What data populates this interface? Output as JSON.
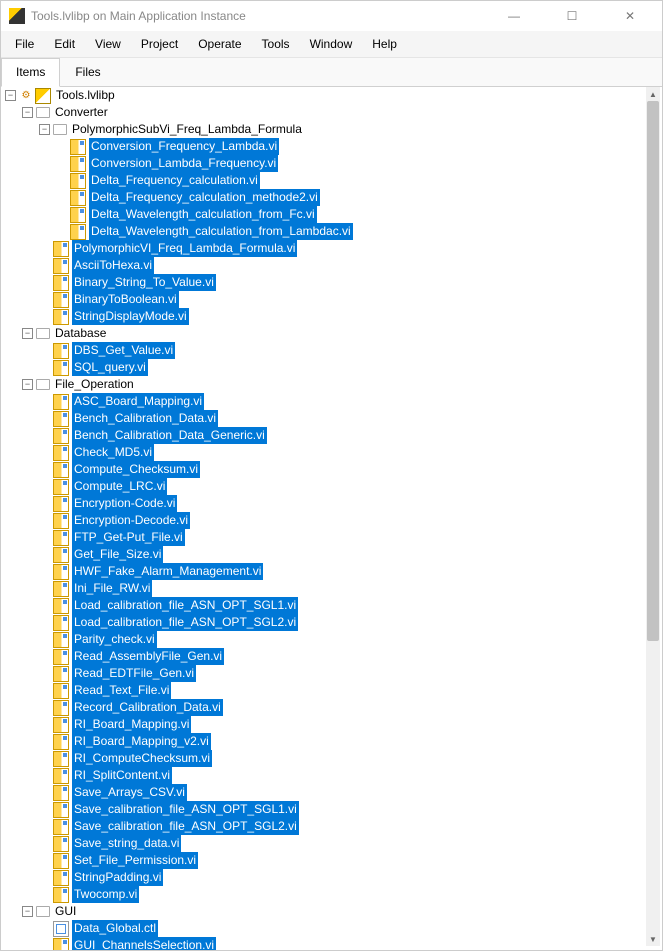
{
  "window": {
    "title": "Tools.lvlibp on Main Application Instance"
  },
  "menu": {
    "items": [
      "File",
      "Edit",
      "View",
      "Project",
      "Operate",
      "Tools",
      "Window",
      "Help"
    ]
  },
  "tabs": {
    "items": [
      "Items",
      "Files"
    ],
    "active": 0
  },
  "tree": {
    "root": {
      "label": "Tools.lvlibp",
      "icon": "lib",
      "expanded": true
    },
    "nodes": [
      {
        "type": "folder",
        "level": 1,
        "label": "Converter",
        "expanded": true,
        "selected": false
      },
      {
        "type": "folder",
        "level": 2,
        "label": "PolymorphicSubVi_Freq_Lambda_Formula",
        "expanded": true,
        "selected": false
      },
      {
        "type": "vi",
        "level": 3,
        "label": "Conversion_Frequency_Lambda.vi",
        "selected": true
      },
      {
        "type": "vi",
        "level": 3,
        "label": "Conversion_Lambda_Frequency.vi",
        "selected": true
      },
      {
        "type": "vi",
        "level": 3,
        "label": "Delta_Frequency_calculation.vi",
        "selected": true
      },
      {
        "type": "vi",
        "level": 3,
        "label": "Delta_Frequency_calculation_methode2.vi",
        "selected": true
      },
      {
        "type": "vi",
        "level": 3,
        "label": "Delta_Wavelength_calculation_from_Fc.vi",
        "selected": true
      },
      {
        "type": "vi",
        "level": 3,
        "label": "Delta_Wavelength_calculation_from_Lambdac.vi",
        "selected": true
      },
      {
        "type": "vi",
        "level": 2,
        "label": "PolymorphicVI_Freq_Lambda_Formula.vi",
        "selected": true
      },
      {
        "type": "vi",
        "level": 2,
        "label": "AsciiToHexa.vi",
        "selected": true
      },
      {
        "type": "vi",
        "level": 2,
        "label": "Binary_String_To_Value.vi",
        "selected": true
      },
      {
        "type": "vi",
        "level": 2,
        "label": "BinaryToBoolean.vi",
        "selected": true
      },
      {
        "type": "vi",
        "level": 2,
        "label": "StringDisplayMode.vi",
        "selected": true
      },
      {
        "type": "folder",
        "level": 1,
        "label": "Database",
        "expanded": true,
        "selected": false
      },
      {
        "type": "vi",
        "level": 2,
        "label": "DBS_Get_Value.vi",
        "selected": true
      },
      {
        "type": "vi",
        "level": 2,
        "label": "SQL_query.vi",
        "selected": true
      },
      {
        "type": "folder",
        "level": 1,
        "label": "File_Operation",
        "expanded": true,
        "selected": false
      },
      {
        "type": "vi",
        "level": 2,
        "label": "ASC_Board_Mapping.vi",
        "selected": true
      },
      {
        "type": "vi",
        "level": 2,
        "label": "Bench_Calibration_Data.vi",
        "selected": true
      },
      {
        "type": "vi",
        "level": 2,
        "label": "Bench_Calibration_Data_Generic.vi",
        "selected": true
      },
      {
        "type": "vi",
        "level": 2,
        "label": "Check_MD5.vi",
        "selected": true
      },
      {
        "type": "vi",
        "level": 2,
        "label": "Compute_Checksum.vi",
        "selected": true
      },
      {
        "type": "vi",
        "level": 2,
        "label": "Compute_LRC.vi",
        "selected": true
      },
      {
        "type": "vi",
        "level": 2,
        "label": "Encryption-Code.vi",
        "selected": true
      },
      {
        "type": "vi",
        "level": 2,
        "label": "Encryption-Decode.vi",
        "selected": true
      },
      {
        "type": "vi",
        "level": 2,
        "label": "FTP_Get-Put_File.vi",
        "selected": true
      },
      {
        "type": "vi",
        "level": 2,
        "label": "Get_File_Size.vi",
        "selected": true
      },
      {
        "type": "vi",
        "level": 2,
        "label": "HWF_Fake_Alarm_Management.vi",
        "selected": true
      },
      {
        "type": "vi",
        "level": 2,
        "label": "Ini_File_RW.vi",
        "selected": true
      },
      {
        "type": "vi",
        "level": 2,
        "label": "Load_calibration_file_ASN_OPT_SGL1.vi",
        "selected": true
      },
      {
        "type": "vi",
        "level": 2,
        "label": "Load_calibration_file_ASN_OPT_SGL2.vi",
        "selected": true
      },
      {
        "type": "vi",
        "level": 2,
        "label": "Parity_check.vi",
        "selected": true
      },
      {
        "type": "vi",
        "level": 2,
        "label": "Read_AssemblyFile_Gen.vi",
        "selected": true
      },
      {
        "type": "vi",
        "level": 2,
        "label": "Read_EDTFile_Gen.vi",
        "selected": true
      },
      {
        "type": "vi",
        "level": 2,
        "label": "Read_Text_File.vi",
        "selected": true
      },
      {
        "type": "vi",
        "level": 2,
        "label": "Record_Calibration_Data.vi",
        "selected": true
      },
      {
        "type": "vi",
        "level": 2,
        "label": "RI_Board_Mapping.vi",
        "selected": true
      },
      {
        "type": "vi",
        "level": 2,
        "label": "RI_Board_Mapping_v2.vi",
        "selected": true
      },
      {
        "type": "vi",
        "level": 2,
        "label": "RI_ComputeChecksum.vi",
        "selected": true
      },
      {
        "type": "vi",
        "level": 2,
        "label": "RI_SplitContent.vi",
        "selected": true
      },
      {
        "type": "vi",
        "level": 2,
        "label": "Save_Arrays_CSV.vi",
        "selected": true
      },
      {
        "type": "vi",
        "level": 2,
        "label": "Save_calibration_file_ASN_OPT_SGL1.vi",
        "selected": true
      },
      {
        "type": "vi",
        "level": 2,
        "label": "Save_calibration_file_ASN_OPT_SGL2.vi",
        "selected": true
      },
      {
        "type": "vi",
        "level": 2,
        "label": "Save_string_data.vi",
        "selected": true
      },
      {
        "type": "vi",
        "level": 2,
        "label": "Set_File_Permission.vi",
        "selected": true
      },
      {
        "type": "vi",
        "level": 2,
        "label": "StringPadding.vi",
        "selected": true
      },
      {
        "type": "vi",
        "level": 2,
        "label": "Twocomp.vi",
        "selected": true
      },
      {
        "type": "folder",
        "level": 1,
        "label": "GUI",
        "expanded": true,
        "selected": false
      },
      {
        "type": "ctl",
        "level": 2,
        "label": "Data_Global.ctl",
        "selected": true
      },
      {
        "type": "vi",
        "level": 2,
        "label": "GUI_ChannelsSelection.vi",
        "selected": true
      }
    ]
  }
}
